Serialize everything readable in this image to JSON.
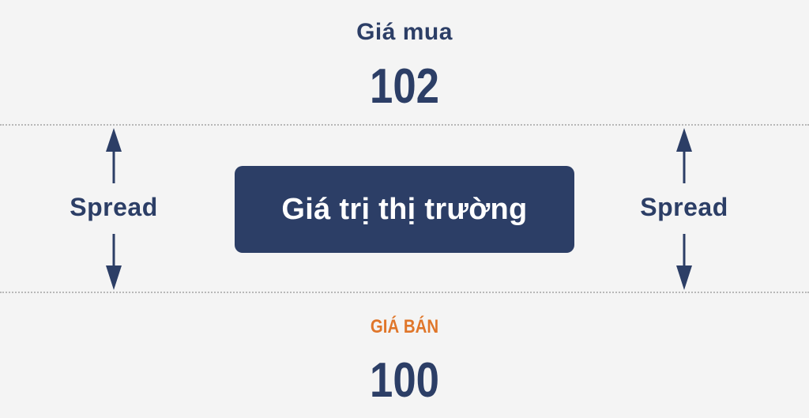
{
  "buy": {
    "label": "Giá mua",
    "value": "102"
  },
  "sell": {
    "label": "GIÁ BÁN",
    "value": "100"
  },
  "market": {
    "label": "Giá trị thị trường"
  },
  "spread": {
    "left_label": "Spread",
    "right_label": "Spread"
  },
  "colors": {
    "primary": "#2c3e66",
    "accent": "#e0762a",
    "background": "#f4f4f4",
    "dotted_line": "#b8b8b8"
  }
}
